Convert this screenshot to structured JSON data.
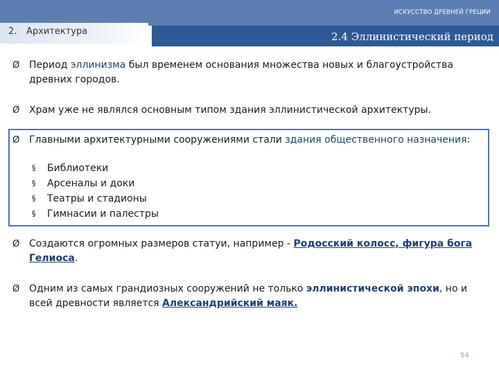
{
  "header": {
    "title": "ИСКУССТВО ДРЕВНЕЙ ГРЕЦИИ",
    "section_number": "2.",
    "section_label": "Архитектура",
    "subtitle": "2.4 Эллинистический период"
  },
  "bullets": [
    {
      "marker": "Ø",
      "parts": [
        "Период ",
        "эллинизма",
        " был временем основания множества новых и благоустройства древних городов."
      ]
    },
    {
      "marker": "Ø",
      "text": "Храм уже не являлся основным типом здания эллинистической архитектуры."
    },
    {
      "marker": "Ø",
      "parts": [
        "Главными архитектурными сооружениями стали ",
        "здания общественного назначения",
        ":"
      ],
      "subitems": [
        {
          "marker": "§",
          "label": "Библиотеки"
        },
        {
          "marker": "§",
          "label": "Арсеналы и доки"
        },
        {
          "marker": "§",
          "label": "Театры и стадионы"
        },
        {
          "marker": "§",
          "label": "Гимнасии и палестры"
        }
      ]
    },
    {
      "marker": "Ø",
      "parts": [
        "Создаются огромных размеров статуи, например - ",
        "Родосский колосс, фигура бога Гелиоса",
        "."
      ]
    },
    {
      "marker": "Ø",
      "parts": [
        "Одним из самых грандиозных сооружений не только ",
        "эллинистической эпохи",
        ", но и всей древности является ",
        "Александрийский маяк."
      ]
    }
  ],
  "footer": {
    "page_number": "54"
  },
  "colors": {
    "topbar": "#5b7fb0",
    "subtitle_bg": "#2d5a96",
    "frame": "#4a74ad",
    "highlight": "#1f3f6e"
  }
}
